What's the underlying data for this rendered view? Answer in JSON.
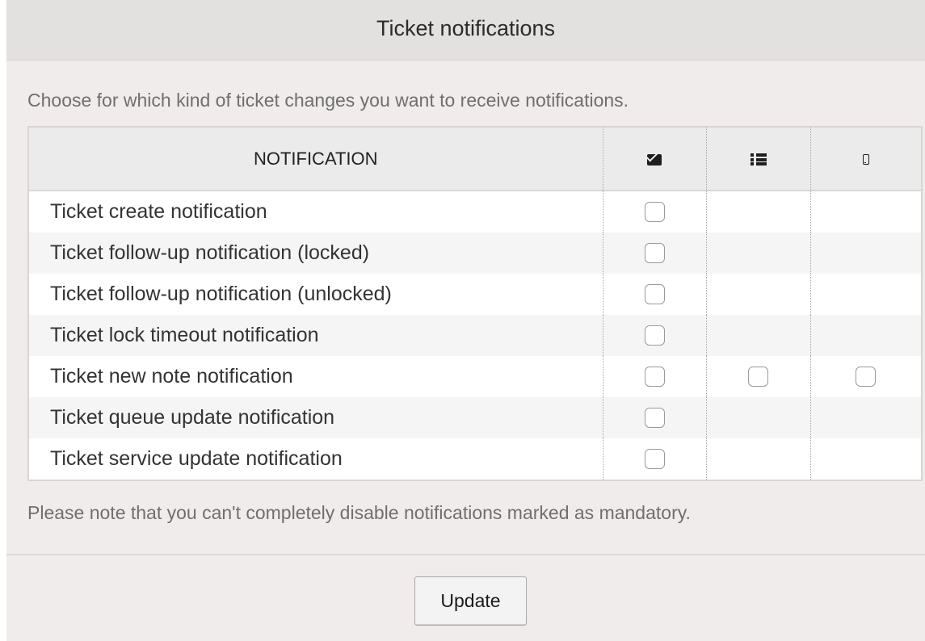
{
  "panel": {
    "title": "Ticket notifications"
  },
  "intro_text": "Choose for which kind of ticket changes you want to receive notifications.",
  "table": {
    "headers": {
      "notification": "NOTIFICATION",
      "email_icon": "envelope-icon",
      "web_icon": "list-icon",
      "sms_icon": "mobile-phone-icon"
    },
    "rows": [
      {
        "label": "Ticket create notification",
        "email": false,
        "web": null,
        "sms": null
      },
      {
        "label": "Ticket follow-up notification (locked)",
        "email": false,
        "web": null,
        "sms": null
      },
      {
        "label": "Ticket follow-up notification (unlocked)",
        "email": false,
        "web": null,
        "sms": null
      },
      {
        "label": "Ticket lock timeout notification",
        "email": false,
        "web": null,
        "sms": null
      },
      {
        "label": "Ticket new note notification",
        "email": false,
        "web": false,
        "sms": false
      },
      {
        "label": "Ticket queue update notification",
        "email": false,
        "web": null,
        "sms": null
      },
      {
        "label": "Ticket service update notification",
        "email": false,
        "web": null,
        "sms": null
      }
    ]
  },
  "note_text": "Please note that you can't completely disable notifications marked as mandatory.",
  "update_button": "Update",
  "colors": {
    "panel_bg": "#efeceb",
    "header_bg": "#e2e1e0",
    "table_header_bg": "#ebebeb",
    "muted_text": "#6f6f6f"
  }
}
